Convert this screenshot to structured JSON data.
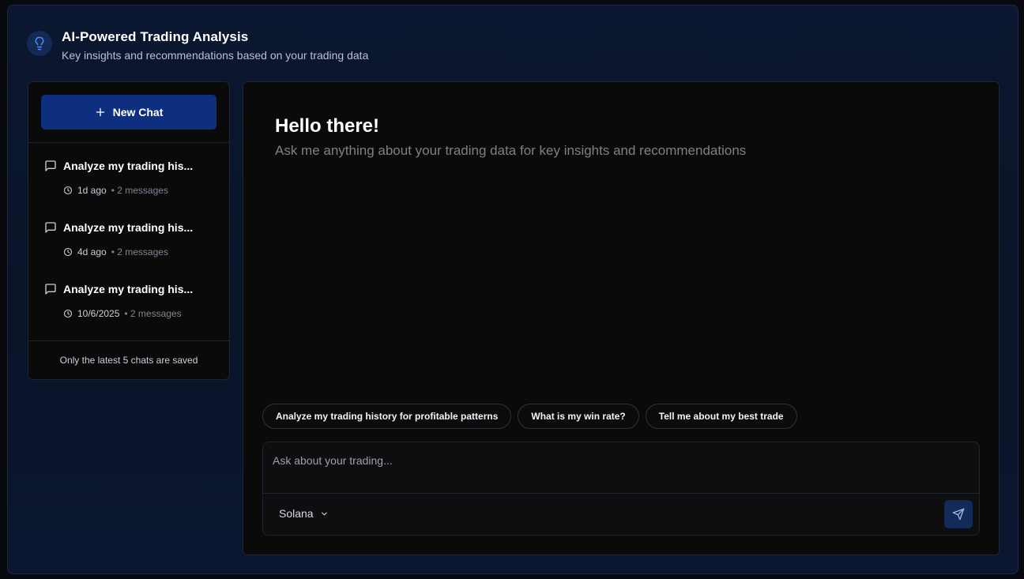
{
  "header": {
    "icon": "lightbulb-icon",
    "title": "AI-Powered Trading Analysis",
    "subtitle": "Key insights and recommendations based on your trading data"
  },
  "sidebar": {
    "new_chat_label": "New Chat",
    "chats": [
      {
        "title": "Analyze my trading his...",
        "time": "1d ago",
        "count": "• 2 messages"
      },
      {
        "title": "Analyze my trading his...",
        "time": "4d ago",
        "count": "• 2 messages"
      },
      {
        "title": "Analyze my trading his...",
        "time": "10/6/2025",
        "count": "• 2 messages"
      }
    ],
    "footer_note": "Only the latest 5 chats are saved"
  },
  "main": {
    "greeting": "Hello there!",
    "prompt_hint": "Ask me anything about your trading data for key insights and recommendations",
    "suggestions": [
      "Analyze my trading history for profitable patterns",
      "What is my win rate?",
      "Tell me about my best trade"
    ],
    "input_placeholder": "Ask about your trading...",
    "network_selected": "Solana"
  },
  "colors": {
    "accent": "#0e2e80",
    "send_button": "#142a58",
    "background": "#0a1428"
  }
}
